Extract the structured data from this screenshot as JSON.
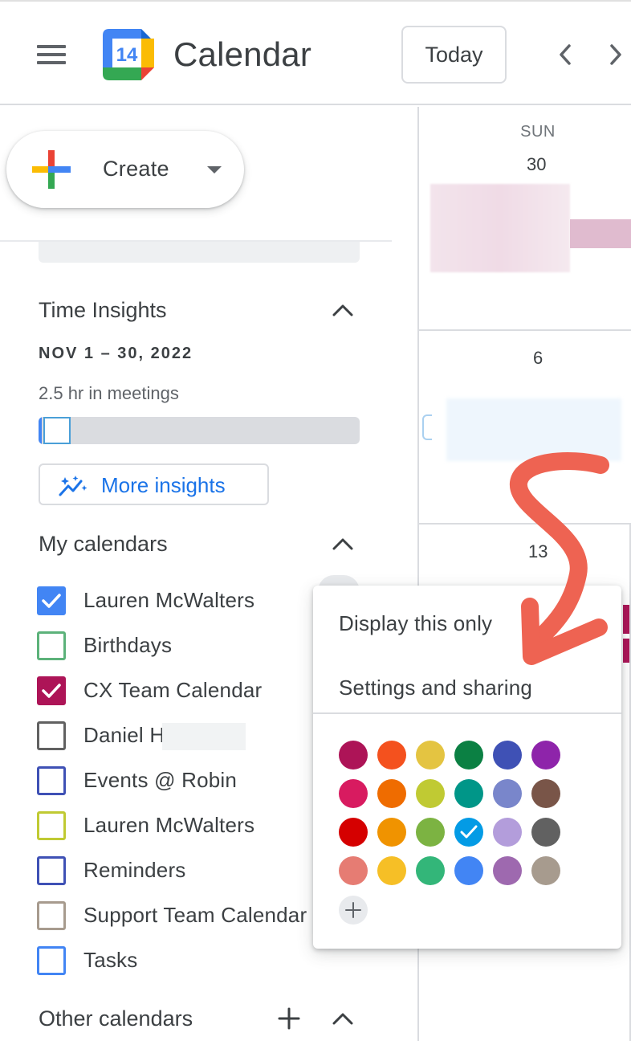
{
  "header": {
    "logo_day": "14",
    "app_title": "Calendar",
    "today_label": "Today"
  },
  "sidebar": {
    "create_label": "Create",
    "time_insights": {
      "title": "Time Insights",
      "range": "NOV 1 – 30, 2022",
      "meetings": "2.5 hr in meetings",
      "more_label": "More insights"
    },
    "my_calendars": {
      "title": "My calendars",
      "items": [
        {
          "label": "Lauren McWalters",
          "color": "#4285f4",
          "checked": true
        },
        {
          "label": "Birthdays",
          "color": "#5cb27a",
          "checked": false
        },
        {
          "label": "CX Team Calendar",
          "color": "#ad1457",
          "checked": true
        },
        {
          "label": "Daniel H",
          "color": "#616161",
          "checked": false
        },
        {
          "label": "Events @ Robin",
          "color": "#3f51b5",
          "checked": false
        },
        {
          "label": "Lauren McWalters",
          "color": "#c0ca33",
          "checked": false
        },
        {
          "label": "Reminders",
          "color": "#3f51b5",
          "checked": false
        },
        {
          "label": "Support Team Calendar",
          "color": "#a79b8e",
          "checked": false
        },
        {
          "label": "Tasks",
          "color": "#4285f4",
          "checked": false
        }
      ]
    },
    "other_calendars": {
      "title": "Other calendars"
    }
  },
  "grid": {
    "weekday": "SUN",
    "days": [
      "30",
      "6",
      "13"
    ]
  },
  "popup": {
    "display_only": "Display this only",
    "settings": "Settings and sharing",
    "colors": [
      [
        "#ad1457",
        "#f4511e",
        "#e4c441",
        "#0b8043",
        "#3f51b5",
        "#8e24aa"
      ],
      [
        "#d81b60",
        "#ef6c00",
        "#c0ca33",
        "#009688",
        "#7986cb",
        "#795548"
      ],
      [
        "#d50000",
        "#f09300",
        "#7cb342",
        "#039be5",
        "#b39ddb",
        "#616161"
      ],
      [
        "#e67c73",
        "#f6bf26",
        "#33b679",
        "#4285f4",
        "#9e69af",
        "#a79b8e"
      ]
    ],
    "selected_color": "#039be5"
  }
}
